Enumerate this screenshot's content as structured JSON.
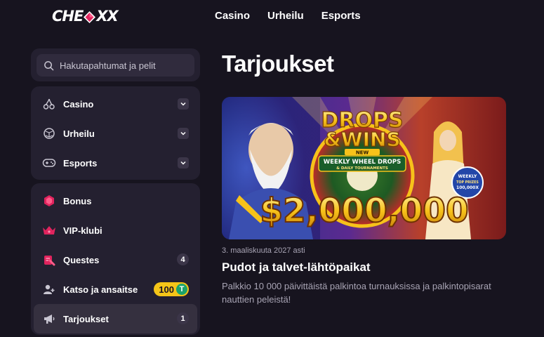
{
  "brand": {
    "logo_text_left": "CHE",
    "logo_text_right": "X",
    "logo_text_end": "X",
    "accent": "#e0245e"
  },
  "topnav": [
    "Casino",
    "Urheilu",
    "Esports"
  ],
  "search": {
    "placeholder": "Hakutapahtumat ja pelit"
  },
  "sidebar": {
    "group1": [
      {
        "label": "Casino",
        "icon": "cherries-icon"
      },
      {
        "label": "Urheilu",
        "icon": "ball-icon"
      },
      {
        "label": "Esports",
        "icon": "gamepad-icon"
      }
    ],
    "group2": [
      {
        "label": "Bonus",
        "icon": "gift-icon"
      },
      {
        "label": "VIP-klubi",
        "icon": "crown-icon"
      },
      {
        "label": "Questes",
        "icon": "quest-icon",
        "count": "4"
      },
      {
        "label": "Katso ja ansaitse",
        "icon": "add-user-icon",
        "coins": "100",
        "coin_symbol": "T"
      },
      {
        "label": "Tarjoukset",
        "icon": "megaphone-icon",
        "count": "1",
        "active": true
      }
    ]
  },
  "main": {
    "title": "Tarjoukset",
    "promo": {
      "banner": {
        "line1": "DROPS",
        "line2": "&WINS",
        "ribbon_new": "NEW",
        "ribbon_main": "WEEKLY WHEEL DROPS",
        "ribbon_sub": "& DAILY TOURNAMENTS",
        "amount": "$2,000,000",
        "badge_top": "WEEKLY",
        "badge_mid": "TOP PRIZES",
        "badge_val": "100,000X"
      },
      "date": "3. maaliskuuta 2027 asti",
      "title": "Pudot ja talvet-lähtöpaikat",
      "description": "Palkkio 10 000 päivittäistä palkintoa turnauksissa ja palkintopisarat nauttien peleistä!"
    }
  }
}
